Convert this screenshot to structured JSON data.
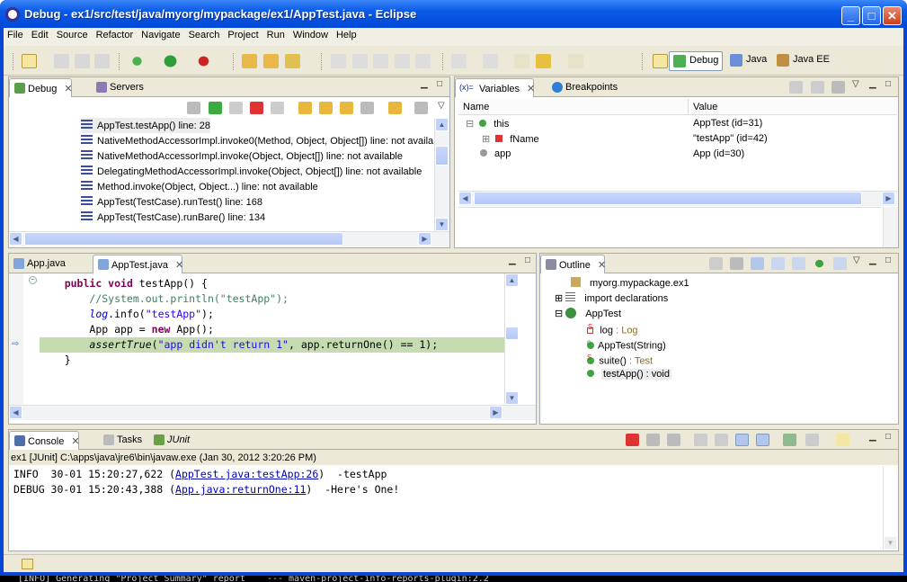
{
  "window": {
    "title": "Debug - ex1/src/test/java/myorg/mypackage/ex1/AppTest.java - Eclipse",
    "min_label": "_",
    "max_label": "□",
    "close_label": "✕"
  },
  "menu": [
    "File",
    "Edit",
    "Source",
    "Refactor",
    "Navigate",
    "Search",
    "Project",
    "Run",
    "Window",
    "Help"
  ],
  "perspectives": [
    {
      "label": "Debug",
      "active": true
    },
    {
      "label": "Java",
      "active": false
    },
    {
      "label": "Java EE",
      "active": false
    }
  ],
  "debug_view": {
    "tabs": [
      "Debug",
      "Servers"
    ],
    "frames": [
      {
        "label": "AppTest.testApp() line: 28",
        "selected": true
      },
      {
        "label": "NativeMethodAccessorImpl.invoke0(Method, Object, Object[]) line: not availa"
      },
      {
        "label": "NativeMethodAccessorImpl.invoke(Object, Object[]) line: not available"
      },
      {
        "label": "DelegatingMethodAccessorImpl.invoke(Object, Object[]) line: not available"
      },
      {
        "label": "Method.invoke(Object, Object...) line: not available"
      },
      {
        "label": "AppTest(TestCase).runTest() line: 168"
      },
      {
        "label": "AppTest(TestCase).runBare() line: 134"
      }
    ]
  },
  "variables_view": {
    "tabs": [
      "Variables",
      "Breakpoints"
    ],
    "tab_prefix": "(x)=",
    "columns": [
      "Name",
      "Value"
    ],
    "rows": [
      {
        "name": "this",
        "value": "AppTest  (id=31)",
        "expander": "⊟"
      },
      {
        "name": "fName",
        "value": "\"testApp\" (id=42)",
        "expander": "⊞"
      },
      {
        "name": "app",
        "value": "App  (id=30)",
        "expander": ""
      }
    ]
  },
  "editor": {
    "tabs": [
      {
        "label": "App.java",
        "active": false
      },
      {
        "label": "AppTest.java",
        "active": true
      }
    ],
    "lines": [
      {
        "indent": "    ",
        "parts": [
          {
            "t": "public void ",
            "c": "kw"
          },
          {
            "t": "testApp() {",
            "c": ""
          }
        ]
      },
      {
        "indent": "        ",
        "parts": [
          {
            "t": "//System.out.println(\"testApp\");",
            "c": "cm"
          }
        ]
      },
      {
        "indent": "        ",
        "parts": [
          {
            "t": "log",
            "c": "fld"
          },
          {
            "t": ".info(",
            "c": ""
          },
          {
            "t": "\"testApp\"",
            "c": "str"
          },
          {
            "t": ");",
            "c": ""
          }
        ]
      },
      {
        "indent": "        ",
        "parts": [
          {
            "t": "App app = ",
            "c": ""
          },
          {
            "t": "new ",
            "c": "kw"
          },
          {
            "t": "App();",
            "c": ""
          }
        ]
      },
      {
        "indent": "        ",
        "parts": [
          {
            "t": "assertTrue",
            "c": "ital"
          },
          {
            "t": "(",
            "c": ""
          },
          {
            "t": "\"app didn't return 1\"",
            "c": "str"
          },
          {
            "t": ", app.returnOne() == 1);",
            "c": ""
          }
        ]
      },
      {
        "indent": "    ",
        "parts": [
          {
            "t": "}",
            "c": ""
          }
        ]
      }
    ]
  },
  "outline": {
    "tab": "Outline",
    "items": [
      {
        "label": "myorg.mypackage.ex1",
        "suffix": "",
        "depth": 0
      },
      {
        "label": "import declarations",
        "suffix": "",
        "depth": 0
      },
      {
        "label": "AppTest",
        "suffix": "",
        "depth": 0
      },
      {
        "label": "log",
        "suffix": " : Log",
        "depth": 1
      },
      {
        "label": "AppTest(String)",
        "suffix": "",
        "depth": 1
      },
      {
        "label": "suite()",
        "suffix": " : Test",
        "depth": 1
      },
      {
        "label": "testApp() : void",
        "suffix": "",
        "depth": 1
      }
    ],
    "markers": {
      "expand": "⊞",
      "collapse": "⊟",
      "static": "S",
      "constructor": "c"
    }
  },
  "console": {
    "tabs": [
      {
        "label": "Console",
        "active": true
      },
      {
        "label": "Tasks",
        "active": false
      },
      {
        "label": "JUnit",
        "active": false
      }
    ],
    "header": "ex1 [JUnit] C:\\apps\\java\\jre6\\bin\\javaw.exe (Jan 30, 2012 3:20:26 PM)",
    "lines": [
      {
        "pre": "INFO  30-01 15:20:27,622 (",
        "link": "AppTest.java:testApp:26",
        "post": ")  -testApp"
      },
      {
        "pre": "DEBUG 30-01 15:20:43,388 (",
        "link": "App.java:returnOne:11",
        "post": ")  -Here's One!"
      }
    ]
  },
  "behind_text": "[INFO] Generating \"Project Summary\" report    --- maven-project-info-reports-plugin:2.2"
}
